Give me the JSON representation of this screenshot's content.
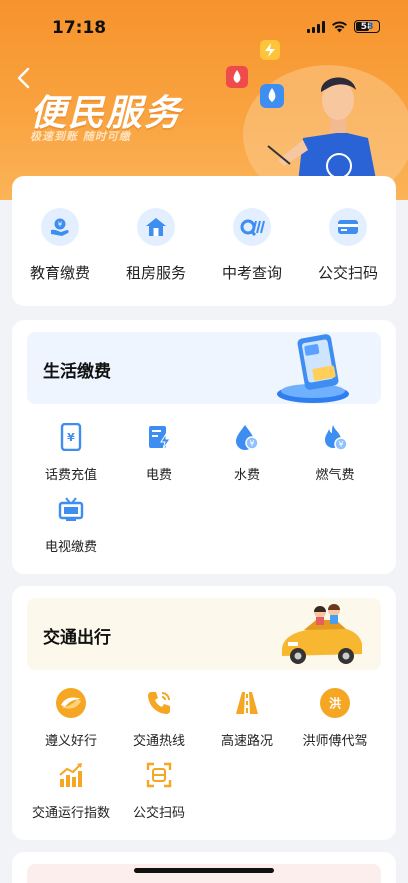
{
  "status_bar": {
    "time": "17:18",
    "battery": "58"
  },
  "banner": {
    "title": "便民服务",
    "subtitle": "极速到账  随时可缴"
  },
  "quick_services": [
    {
      "label": "教育缴费",
      "icon": "education-payment-icon"
    },
    {
      "label": "租房服务",
      "icon": "house-rental-icon"
    },
    {
      "label": "中考查询",
      "icon": "exam-query-icon"
    },
    {
      "label": "公交扫码",
      "icon": "bus-card-icon"
    }
  ],
  "life_payment": {
    "title": "生活缴费",
    "items": [
      {
        "label": "话费充值",
        "icon": "phone-recharge-icon"
      },
      {
        "label": "电费",
        "icon": "electricity-bill-icon"
      },
      {
        "label": "水费",
        "icon": "water-bill-icon"
      },
      {
        "label": "燃气费",
        "icon": "gas-bill-icon"
      },
      {
        "label": "电视缴费",
        "icon": "tv-bill-icon"
      }
    ]
  },
  "traffic": {
    "title": "交通出行",
    "items": [
      {
        "label": "遵义好行",
        "icon": "zunyi-travel-icon"
      },
      {
        "label": "交通热线",
        "icon": "traffic-hotline-icon"
      },
      {
        "label": "高速路况",
        "icon": "highway-road-icon"
      },
      {
        "label": "洪师傅代驾",
        "icon": "designated-driver-icon"
      },
      {
        "label": "交通运行指数",
        "icon": "traffic-index-icon"
      },
      {
        "label": "公交扫码",
        "icon": "bus-scan-icon"
      }
    ]
  },
  "colors": {
    "accent_orange": "#f7932d",
    "icon_blue": "#3d8ef0",
    "icon_orange": "#f5a623"
  }
}
